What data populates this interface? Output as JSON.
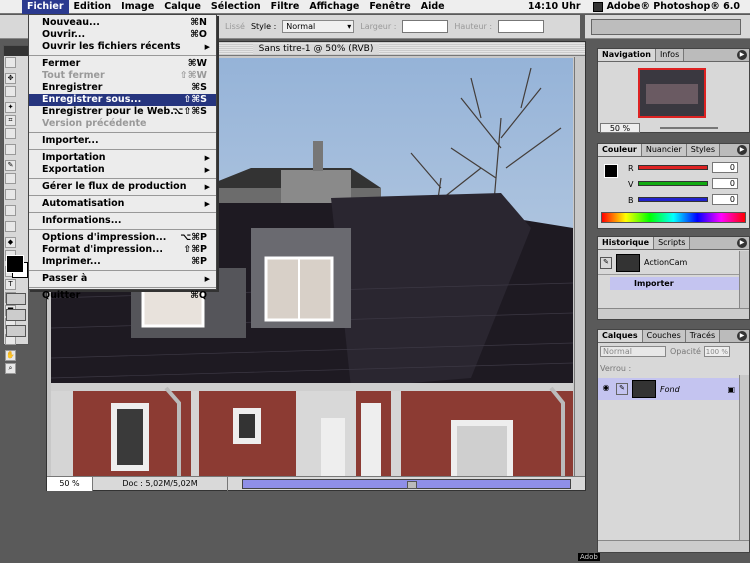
{
  "menubar": {
    "items": [
      "Fichier",
      "Edition",
      "Image",
      "Calque",
      "Sélection",
      "Filtre",
      "Affichage",
      "Fenêtre",
      "Aide"
    ],
    "clock": "14:10 Uhr",
    "app": "Adobe® Photoshop® 6.0"
  },
  "options": {
    "lisse": "Lissé",
    "style_label": "Style :",
    "style_value": "Normal",
    "largeur": "Largeur :",
    "hauteur": "Hauteur :"
  },
  "document": {
    "title": "Sans titre-1 @ 50% (RVB)",
    "zoom": "50 %",
    "doc_size": "Doc : 5,02M/5,02M"
  },
  "file_menu": [
    {
      "label": "Nouveau...",
      "sc": "⌘N"
    },
    {
      "label": "Ouvrir...",
      "sc": "⌘O"
    },
    {
      "label": "Ouvrir les fichiers récents",
      "sub": true
    },
    {
      "sep": true
    },
    {
      "label": "Fermer",
      "sc": "⌘W"
    },
    {
      "label": "Tout fermer",
      "sc": "⇧⌘W",
      "dis": true
    },
    {
      "label": "Enregistrer",
      "sc": "⌘S"
    },
    {
      "label": "Enregistrer sous...",
      "sc": "⇧⌘S",
      "hl": true
    },
    {
      "label": "Enregistrer pour le Web...",
      "sc": "⌥⇧⌘S"
    },
    {
      "label": "Version précédente",
      "dis": true
    },
    {
      "sep": true
    },
    {
      "label": "Importer..."
    },
    {
      "sep": true
    },
    {
      "label": "Importation",
      "sub": true
    },
    {
      "label": "Exportation",
      "sub": true
    },
    {
      "sep": true
    },
    {
      "label": "Gérer le flux de production",
      "sub": true
    },
    {
      "sep": true
    },
    {
      "label": "Automatisation",
      "sub": true
    },
    {
      "sep": true
    },
    {
      "label": "Informations..."
    },
    {
      "sep": true
    },
    {
      "label": "Options d'impression...",
      "sc": "⌥⌘P"
    },
    {
      "label": "Format d'impression...",
      "sc": "⇧⌘P"
    },
    {
      "label": "Imprimer...",
      "sc": "⌘P"
    },
    {
      "sep": true
    },
    {
      "label": "Passer à",
      "sub": true
    },
    {
      "sep": true
    },
    {
      "label": "Quitter",
      "sc": "⌘Q"
    }
  ],
  "navigator": {
    "tabs": [
      "Navigation",
      "Infos"
    ],
    "zoom": "50 %"
  },
  "color": {
    "tabs": [
      "Couleur",
      "Nuancier",
      "Styles"
    ],
    "channels": [
      {
        "label": "R",
        "value": "0",
        "color": "#d22"
      },
      {
        "label": "V",
        "value": "0",
        "color": "#1a1"
      },
      {
        "label": "B",
        "value": "0",
        "color": "#22c"
      }
    ]
  },
  "history": {
    "tabs": [
      "Historique",
      "Scripts"
    ],
    "snapshot": "ActionCam",
    "state": "Importer"
  },
  "layers": {
    "tabs": [
      "Calques",
      "Couches",
      "Tracés"
    ],
    "blend": "Normal",
    "opacity_label": "Opacité :",
    "opacity": "100 %",
    "lock_label": "Verrou :",
    "layer": "Fond"
  },
  "footer_text": "Adob"
}
